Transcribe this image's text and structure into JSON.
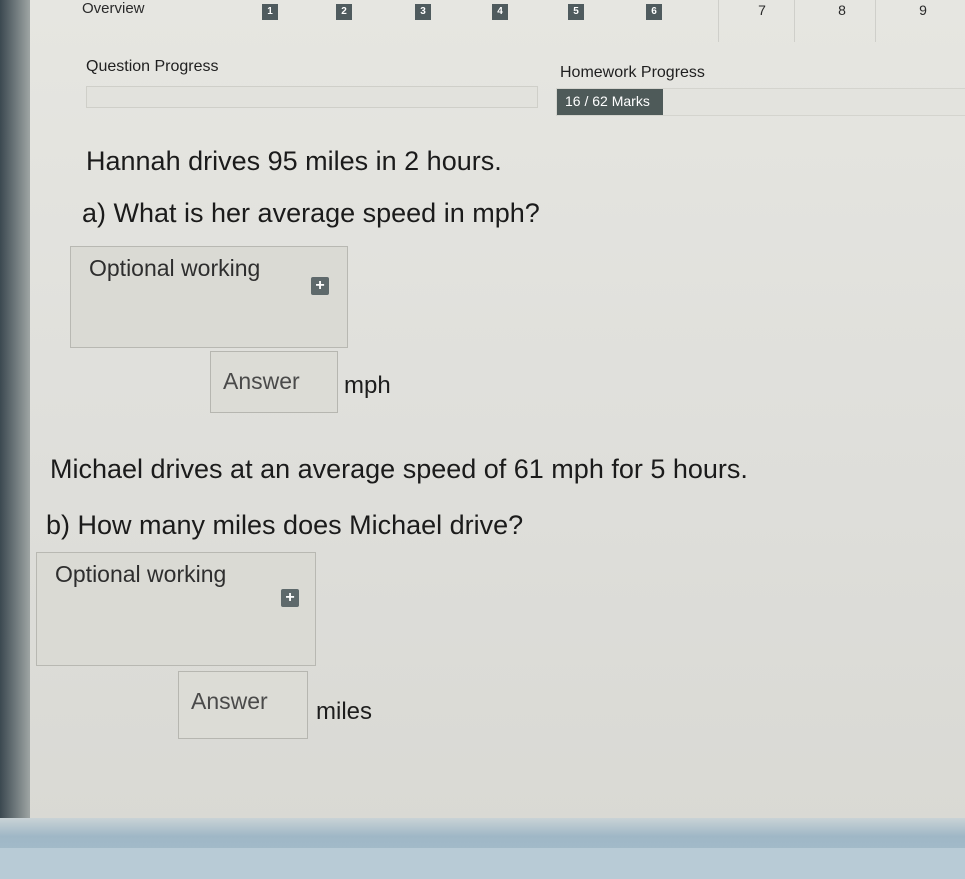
{
  "nav": {
    "overview_label": "Overview",
    "tabs": [
      "1",
      "2",
      "3",
      "4",
      "5",
      "6",
      "7",
      "8",
      "9"
    ]
  },
  "progress": {
    "question_label": "Question Progress",
    "homework_label": "Homework Progress",
    "marks_text": "16 / 62 Marks",
    "marks_fraction": 0.258
  },
  "question_a": {
    "stem": "Hannah drives 95 miles in 2 hours.",
    "prompt": "a) What is her average speed in mph?",
    "working_label": "Optional working",
    "answer_placeholder": "Answer",
    "unit": "mph"
  },
  "question_b": {
    "stem": "Michael drives at an average speed of 61 mph for 5 hours.",
    "prompt": "b) How many miles does Michael drive?",
    "working_label": "Optional working",
    "answer_placeholder": "Answer",
    "unit": "miles"
  },
  "icons": {
    "add_working": "plus-icon"
  }
}
